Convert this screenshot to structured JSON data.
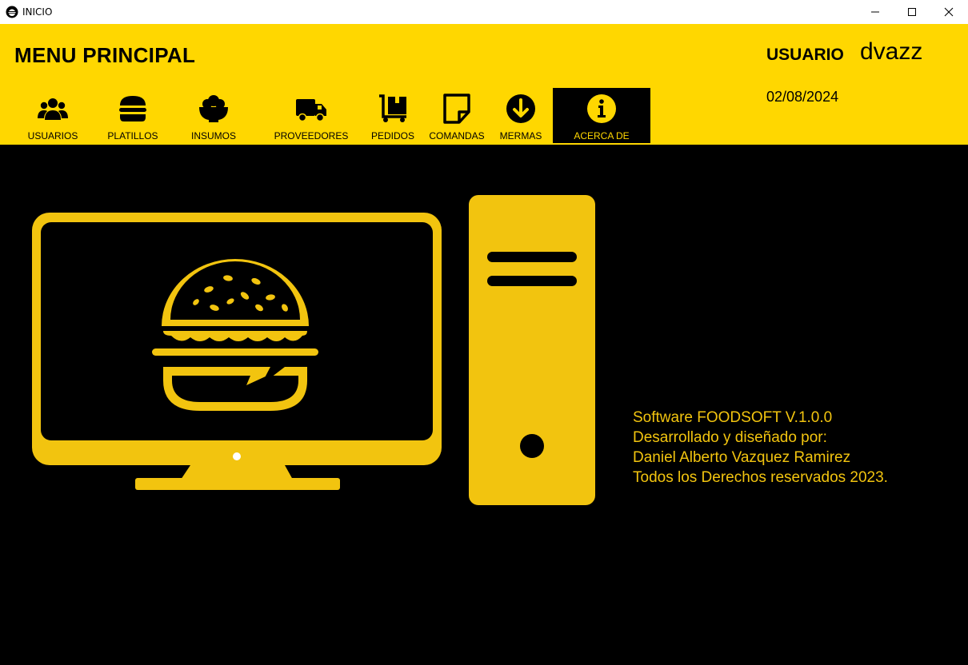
{
  "window": {
    "title": "INICIO",
    "icons": {
      "app": "burger-logo-icon",
      "minimize": "minimize-icon",
      "maximize": "maximize-icon",
      "close": "close-icon"
    }
  },
  "header": {
    "menu_title": "MENU PRINCIPAL",
    "user_label": "USUARIO",
    "user_name": "dvazz",
    "date": "02/08/2024"
  },
  "nav": {
    "items": [
      {
        "label": "USUARIOS",
        "icon": "users-icon"
      },
      {
        "label": "PLATILLOS",
        "icon": "burger-icon"
      },
      {
        "label": "INSUMOS",
        "icon": "bowl-icon"
      },
      {
        "label": "PROVEEDORES",
        "icon": "truck-icon"
      },
      {
        "label": "PEDIDOS",
        "icon": "dolly-icon"
      },
      {
        "label": "COMANDAS",
        "icon": "note-icon"
      },
      {
        "label": "MERMAS",
        "icon": "arrow-down-circle-icon"
      },
      {
        "label": "ACERCA DE",
        "icon": "info-icon",
        "active": true
      }
    ]
  },
  "about": {
    "line1": "Software FOODSOFT V.1.0.0",
    "line2": "Desarrollado y diseñado por:",
    "line3": "Daniel Alberto Vazquez Ramirez",
    "line4": "Todos los Derechos reservados 2023."
  },
  "colors": {
    "header_bg": "#FFD700",
    "content_bg": "#000000",
    "accent_yellow": "#F2C40F",
    "active_nav_bg": "#000000"
  }
}
